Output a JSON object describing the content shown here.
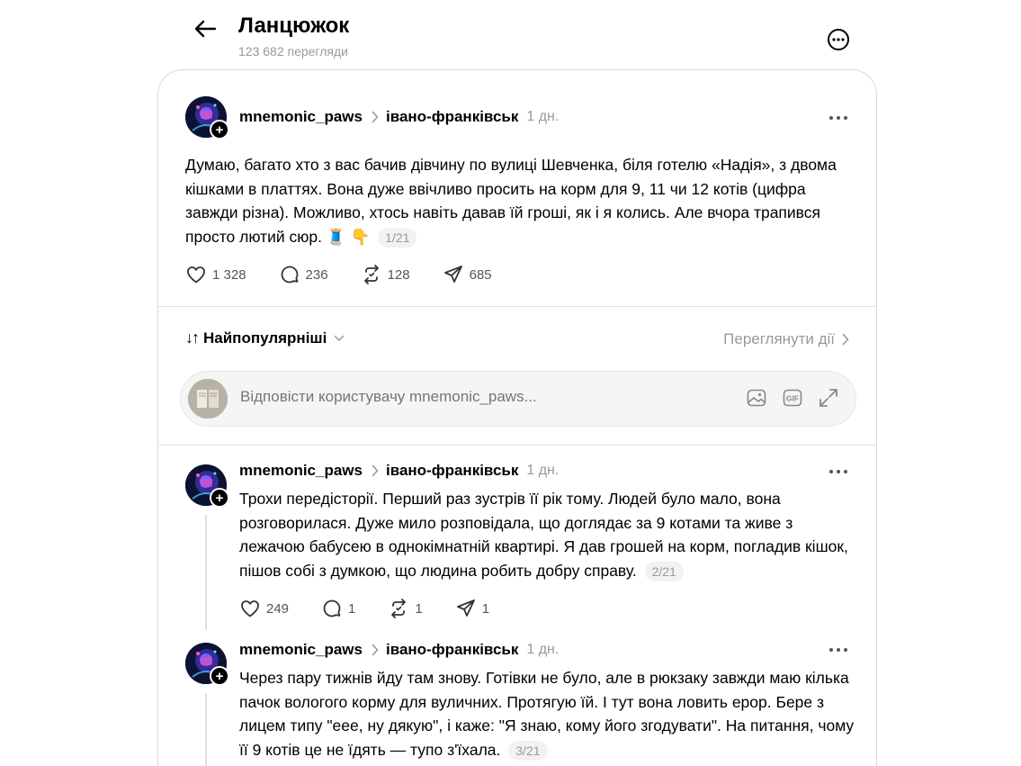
{
  "header": {
    "title": "Ланцюжок",
    "views": "123 682 перегляди"
  },
  "icons": {
    "back": "arrow-left-icon",
    "more": "more-circle-icon",
    "like": "heart-icon",
    "comment": "comment-icon",
    "repost": "repost-icon",
    "share": "send-icon",
    "image": "image-icon",
    "gif": "gif-icon",
    "expand": "expand-icon"
  },
  "main_post": {
    "username": "mnemonic_paws",
    "community": "івано-франківськ",
    "time": "1 дн.",
    "text": "Думаю, багато хто з вас бачив дівчину по вулиці Шевченка, біля готелю «Надія», з двома кішками в платтях. Вона дуже ввічливо просить на корм для 9, 11 чи 12 котів (цифра завжди різна). Можливо, хтось навіть давав їй гроші, як і я колись. Але вчора трапився просто лютий сюр. 🧵 👇",
    "counter": "1/21",
    "likes": "1 328",
    "comments": "236",
    "reposts": "128",
    "shares": "685"
  },
  "sort": {
    "label": "Найпопулярніші",
    "view_actions": "Переглянути дії"
  },
  "reply": {
    "placeholder": "Відповісти користувачу mnemonic_paws..."
  },
  "thread": [
    {
      "username": "mnemonic_paws",
      "community": "івано-франківськ",
      "time": "1 дн.",
      "text": "Трохи передісторії. Перший раз зустрів її рік тому. Людей було мало, вона розговорилася. Дуже мило розповідала, що доглядає за 9 котами та живе з лежачою бабусею в однокімнатній квартирі. Я дав грошей на корм, погладив кішок, пішов собі з думкою, що людина робить добру справу.",
      "counter": "2/21",
      "likes": "249",
      "comments": "1",
      "reposts": "1",
      "shares": "1"
    },
    {
      "username": "mnemonic_paws",
      "community": "івано-франківськ",
      "time": "1 дн.",
      "text": "Через пару тижнів йду там знову. Готівки не було, але в рюкзаку завжди маю кілька пачок вологого корму для вуличних. Протягую їй. І тут вона ловить ерор. Бере з лицем типу \"еее, ну дякую\", і каже: \"Я знаю, кому його згодувати\". На питання, чому її 9 котів це не їдять — тупо з'їхала.",
      "counter": "3/21"
    }
  ]
}
